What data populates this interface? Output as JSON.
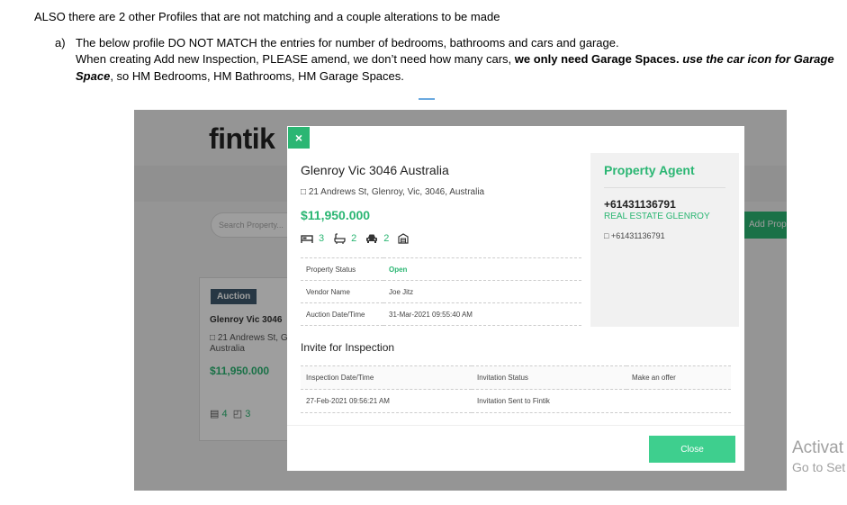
{
  "document": {
    "line1": "ALSO there are 2 other Profiles that are not matching and a couple alterations to be made",
    "item_marker": "a)",
    "line2": "The below profile DO NOT MATCH the entries for number of bedrooms, bathrooms and cars and garage.",
    "line3_plain": "When creating Add new Inspection, PLEASE amend, we don’t need how many cars, ",
    "line3_bold": "we only need Garage Spaces.",
    "line3_bold_italic": "use the car icon for Garage",
    "line4_bold_italic": "Space",
    "line4_plain": ", so HM Bedrooms, HM Bathrooms, HM Garage Spaces."
  },
  "background_app": {
    "logo_text": "fintik",
    "search_placeholder": "Search Property...",
    "add_button": "Add Prop",
    "card": {
      "badge": "Auction",
      "title": "Glenroy Vic 3046",
      "address": "□ 21 Andrews St, G Australia",
      "price": "$11,950.000",
      "bedrooms": "4",
      "bathrooms": "3"
    }
  },
  "modal": {
    "close_x": "×",
    "title": "Glenroy Vic 3046 Australia",
    "address": "□ 21 Andrews St, Glenroy, Vic, 3046, Australia",
    "price": "$11,950.000",
    "features": {
      "bedrooms": "3",
      "bathrooms": "2",
      "cars": "2"
    },
    "details": [
      {
        "label": "Property Status",
        "value": "Open"
      },
      {
        "label": "Vendor Name",
        "value": "Joe Jitz"
      },
      {
        "label": "Auction Date/Time",
        "value": "31-Mar-2021 09:55:40 AM"
      }
    ],
    "invite_title": "Invite for Inspection",
    "invite_columns": [
      "Inspection Date/Time",
      "Invitation Status",
      "Make an offer"
    ],
    "invite_rows": [
      {
        "date": "27-Feb-2021 09:56:21 AM",
        "status": "Invitation Sent to Fintik",
        "offer": ""
      }
    ],
    "agent": {
      "heading": "Property Agent",
      "phone": "+61431136791",
      "agency": "REAL ESTATE GLENROY",
      "phone_secondary": "□ +61431136791"
    },
    "close_button": "Close"
  },
  "watermark": {
    "line1": "Activat",
    "line2": "Go to Set"
  },
  "colors": {
    "accent": "#2bb673",
    "close_button": "#3ecf8e",
    "badge": "#3f5a6e"
  }
}
